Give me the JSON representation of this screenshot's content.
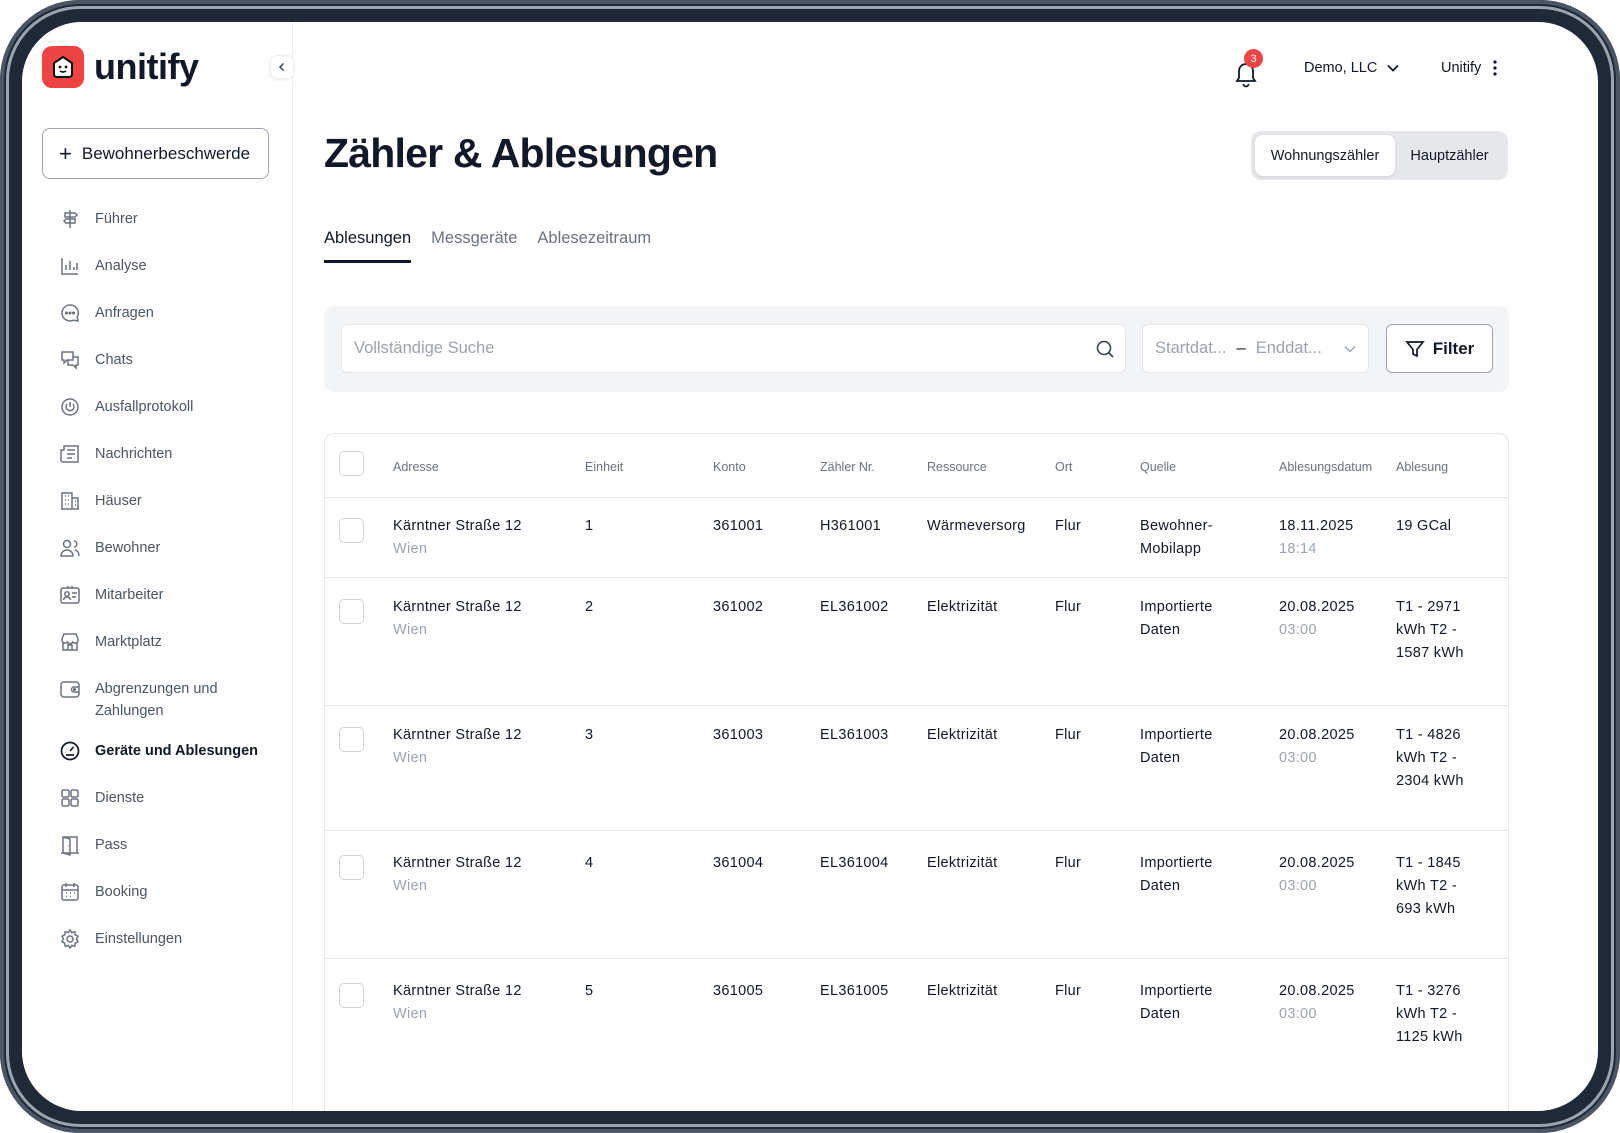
{
  "app": {
    "name": "unitify"
  },
  "sidebar": {
    "new_button": "Bewohnerbeschwerde",
    "items": [
      {
        "label": "Führer",
        "icon": "signpost-icon"
      },
      {
        "label": "Analyse",
        "icon": "bar-chart-icon"
      },
      {
        "label": "Anfragen",
        "icon": "chat-bubble-icon"
      },
      {
        "label": "Chats",
        "icon": "chats-icon"
      },
      {
        "label": "Ausfallprotokoll",
        "icon": "power-icon"
      },
      {
        "label": "Nachrichten",
        "icon": "newspaper-icon"
      },
      {
        "label": "Häuser",
        "icon": "building-icon"
      },
      {
        "label": "Bewohner",
        "icon": "users-icon"
      },
      {
        "label": "Mitarbeiter",
        "icon": "id-card-icon"
      },
      {
        "label": "Marktplatz",
        "icon": "store-icon"
      },
      {
        "label": "Abgrenzungen und Zahlungen",
        "icon": "wallet-icon"
      },
      {
        "label": "Geräte und Ablesungen",
        "icon": "gauge-icon",
        "active": true
      },
      {
        "label": "Dienste",
        "icon": "grid-icon"
      },
      {
        "label": "Pass",
        "icon": "door-icon"
      },
      {
        "label": "Booking",
        "icon": "calendar-icon"
      },
      {
        "label": "Einstellungen",
        "icon": "gear-icon"
      }
    ]
  },
  "header": {
    "notifications": "3",
    "organization": "Demo, LLC",
    "user": "Unitify"
  },
  "page": {
    "title": "Zähler & Ablesungen",
    "segment": {
      "active": "Wohnungszähler",
      "inactive": "Hauptzähler"
    },
    "tabs": [
      "Ablesungen",
      "Messgeräte",
      "Ablesezeitraum"
    ],
    "active_tab": "Ablesungen"
  },
  "filters": {
    "search_placeholder": "Vollständige Suche",
    "start_placeholder": "Startdat...",
    "end_placeholder": "Enddat...",
    "filter_label": "Filter"
  },
  "table": {
    "columns": [
      "Adresse",
      "Einheit",
      "Konto",
      "Zähler Nr.",
      "Ressource",
      "Ort",
      "Quelle",
      "Ablesungsdatum",
      "Ablesung"
    ],
    "rows": [
      {
        "address": "Kärntner Straße 12",
        "city": "Wien",
        "unit": "1",
        "account": "361001",
        "meter": "H361001",
        "resource": "Wärmeversorgung",
        "location": "Flur",
        "source": "Bewohner-Mobilapp",
        "date": "18.11.2025",
        "time": "18:14",
        "reading": "19 GCal"
      },
      {
        "address": "Kärntner Straße 12",
        "city": "Wien",
        "unit": "2",
        "account": "361002",
        "meter": "EL361002",
        "resource": "Elektrizität",
        "location": "Flur",
        "source": "Importierte Daten",
        "date": "20.08.2025",
        "time": "03:00",
        "reading": "T1 - 2971 kWh T2 - 1587 kWh"
      },
      {
        "address": "Kärntner Straße 12",
        "city": "Wien",
        "unit": "3",
        "account": "361003",
        "meter": "EL361003",
        "resource": "Elektrizität",
        "location": "Flur",
        "source": "Importierte Daten",
        "date": "20.08.2025",
        "time": "03:00",
        "reading": "T1 - 4826 kWh T2 - 2304 kWh"
      },
      {
        "address": "Kärntner Straße 12",
        "city": "Wien",
        "unit": "4",
        "account": "361004",
        "meter": "EL361004",
        "resource": "Elektrizität",
        "location": "Flur",
        "source": "Importierte Daten",
        "date": "20.08.2025",
        "time": "03:00",
        "reading": "T1 - 1845 kWh T2 - 693 kWh"
      },
      {
        "address": "Kärntner Straße 12",
        "city": "Wien",
        "unit": "5",
        "account": "361005",
        "meter": "EL361005",
        "resource": "Elektrizität",
        "location": "Flur",
        "source": "Importierte Daten",
        "date": "20.08.2025",
        "time": "03:00",
        "reading": "T1 - 3276 kWh T2 - 1125 kWh"
      }
    ]
  },
  "colors": {
    "brand": "#ef4444",
    "text": "#111827",
    "muted": "#6b7280",
    "border": "#e5e7eb"
  }
}
